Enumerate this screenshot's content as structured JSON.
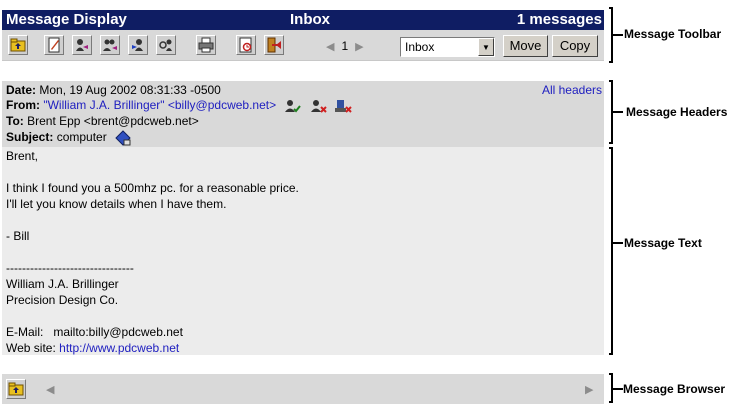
{
  "toolbar": {
    "title": "Message Display",
    "folder_title": "Inbox",
    "message_count": "1 messages",
    "buttons": [
      {
        "icon": "folder-up-icon"
      },
      {
        "icon": "compose-icon"
      },
      {
        "icon": "reply-icon"
      },
      {
        "icon": "reply-all-icon"
      },
      {
        "icon": "forward-icon"
      },
      {
        "icon": "forward-as-attachment-icon"
      },
      {
        "icon": "print-icon"
      },
      {
        "icon": "view-source-icon"
      },
      {
        "icon": "delete-icon"
      }
    ],
    "page_number": "1",
    "folder_select": {
      "selected": "Inbox"
    },
    "move_label": "Move",
    "copy_label": "Copy"
  },
  "headers": {
    "date_label": "Date:",
    "date_value": "Mon, 19 Aug 2002 08:31:33 -0500",
    "from_label": "From:",
    "from_value": "\"William J.A. Brillinger\" <billy@pdcweb.net>",
    "to_label": "To:",
    "to_value": "Brent Epp <brent@pdcweb.net>",
    "subject_label": "Subject:",
    "subject_value": "computer",
    "all_headers_label": "All headers"
  },
  "message_text": {
    "lines": [
      "Brent,",
      "",
      "I think I found you a 500mhz pc. for a reasonable price.",
      "I'll let you know details when I have them.",
      "",
      "- Bill",
      "",
      "--------------------------------",
      "William J.A. Brillinger",
      "Precision Design Co.",
      "",
      "E-Mail:   mailto:billy@pdcweb.net",
      "Web site: "
    ],
    "website_link": "http://www.pdcweb.net"
  },
  "callouts": {
    "toolbar": "Message Toolbar",
    "headers": "Message Headers",
    "text": "Message Text",
    "browser": "Message Browser"
  },
  "colors": {
    "title_bar": "#0f1d63",
    "link": "#2020c0",
    "toolbar_bg": "#d9d9d9",
    "text_bg": "#ececec"
  }
}
